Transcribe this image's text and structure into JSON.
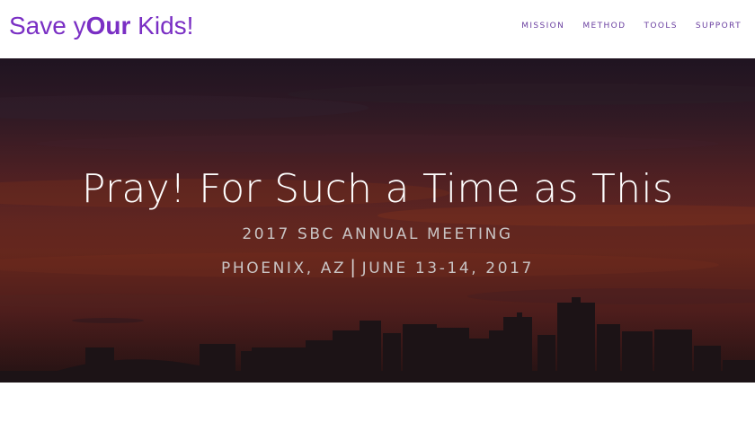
{
  "header": {
    "logo_prefix": "Save y",
    "logo_bold": "Our",
    "logo_suffix": " Kids!",
    "nav": [
      {
        "label": "MISSION"
      },
      {
        "label": "METHOD"
      },
      {
        "label": "TOOLS"
      },
      {
        "label": "SUPPORT"
      }
    ]
  },
  "hero": {
    "title": "Pray! For Such a Time as This",
    "subtitle": "2017 SBC ANNUAL MEETING",
    "location_city": "PHOENIX, AZ",
    "location_separator": "|",
    "location_dates": "JUNE 13-14, 2017"
  },
  "colors": {
    "logo": "#7a2fc4",
    "nav": "#6a3fa0",
    "hero_title": "#ffffff",
    "hero_subtitle": "#c9c4c4"
  }
}
